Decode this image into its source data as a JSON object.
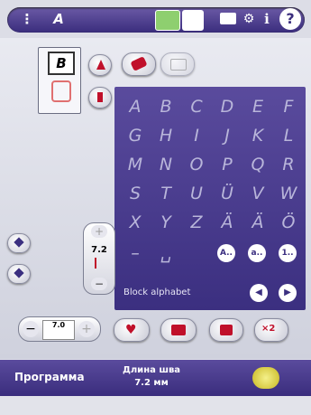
{
  "toolbar": {
    "icons": [
      "stitch-menu-icon",
      "alphabet-menu-icon",
      "sew-mode-icon",
      "embroidery-mode-icon",
      "folder-icon",
      "settings-icon",
      "info-icon",
      "help-icon"
    ],
    "help_label": "?",
    "info_label": "i",
    "alphabet_label": "A",
    "accent": "#3a2d7d"
  },
  "stitch_preview": {
    "letter": "B"
  },
  "alphabet_panel": {
    "rows": [
      [
        "A",
        "B",
        "C",
        "D",
        "E",
        "F"
      ],
      [
        "G",
        "H",
        "I",
        "J",
        "K",
        "L"
      ],
      [
        "M",
        "N",
        "O",
        "P",
        "Q",
        "R"
      ],
      [
        "S",
        "T",
        "U",
        "Ü",
        "V",
        "W"
      ],
      [
        "X",
        "Y",
        "Z",
        "Ä",
        "Ä",
        "Ö"
      ],
      [
        "–",
        "␣"
      ]
    ],
    "case_buttons": [
      "A..",
      "a..",
      "1.."
    ],
    "font_name": "Block alphabet"
  },
  "stitch_width": {
    "value": "7.2"
  },
  "stitch_length_small": {
    "value": "7.0"
  },
  "bottom_bar": {
    "program_label": "Программа",
    "length_title": "Длина шва",
    "length_value": "7.2 мм"
  }
}
